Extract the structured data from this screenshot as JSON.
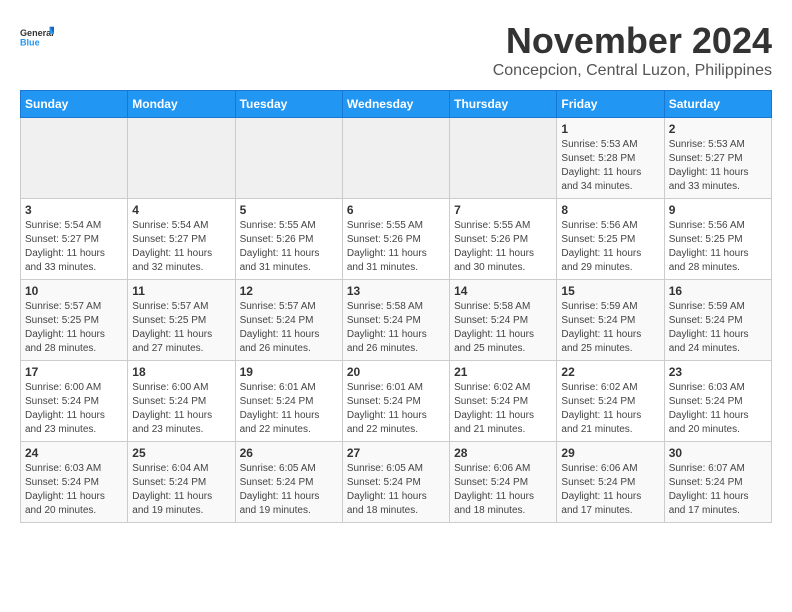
{
  "logo": {
    "line1": "General",
    "line2": "Blue"
  },
  "title": "November 2024",
  "location": "Concepcion, Central Luzon, Philippines",
  "weekdays": [
    "Sunday",
    "Monday",
    "Tuesday",
    "Wednesday",
    "Thursday",
    "Friday",
    "Saturday"
  ],
  "weeks": [
    [
      {
        "day": "",
        "info": ""
      },
      {
        "day": "",
        "info": ""
      },
      {
        "day": "",
        "info": ""
      },
      {
        "day": "",
        "info": ""
      },
      {
        "day": "",
        "info": ""
      },
      {
        "day": "1",
        "info": "Sunrise: 5:53 AM\nSunset: 5:28 PM\nDaylight: 11 hours and 34 minutes."
      },
      {
        "day": "2",
        "info": "Sunrise: 5:53 AM\nSunset: 5:27 PM\nDaylight: 11 hours and 33 minutes."
      }
    ],
    [
      {
        "day": "3",
        "info": "Sunrise: 5:54 AM\nSunset: 5:27 PM\nDaylight: 11 hours and 33 minutes."
      },
      {
        "day": "4",
        "info": "Sunrise: 5:54 AM\nSunset: 5:27 PM\nDaylight: 11 hours and 32 minutes."
      },
      {
        "day": "5",
        "info": "Sunrise: 5:55 AM\nSunset: 5:26 PM\nDaylight: 11 hours and 31 minutes."
      },
      {
        "day": "6",
        "info": "Sunrise: 5:55 AM\nSunset: 5:26 PM\nDaylight: 11 hours and 31 minutes."
      },
      {
        "day": "7",
        "info": "Sunrise: 5:55 AM\nSunset: 5:26 PM\nDaylight: 11 hours and 30 minutes."
      },
      {
        "day": "8",
        "info": "Sunrise: 5:56 AM\nSunset: 5:25 PM\nDaylight: 11 hours and 29 minutes."
      },
      {
        "day": "9",
        "info": "Sunrise: 5:56 AM\nSunset: 5:25 PM\nDaylight: 11 hours and 28 minutes."
      }
    ],
    [
      {
        "day": "10",
        "info": "Sunrise: 5:57 AM\nSunset: 5:25 PM\nDaylight: 11 hours and 28 minutes."
      },
      {
        "day": "11",
        "info": "Sunrise: 5:57 AM\nSunset: 5:25 PM\nDaylight: 11 hours and 27 minutes."
      },
      {
        "day": "12",
        "info": "Sunrise: 5:57 AM\nSunset: 5:24 PM\nDaylight: 11 hours and 26 minutes."
      },
      {
        "day": "13",
        "info": "Sunrise: 5:58 AM\nSunset: 5:24 PM\nDaylight: 11 hours and 26 minutes."
      },
      {
        "day": "14",
        "info": "Sunrise: 5:58 AM\nSunset: 5:24 PM\nDaylight: 11 hours and 25 minutes."
      },
      {
        "day": "15",
        "info": "Sunrise: 5:59 AM\nSunset: 5:24 PM\nDaylight: 11 hours and 25 minutes."
      },
      {
        "day": "16",
        "info": "Sunrise: 5:59 AM\nSunset: 5:24 PM\nDaylight: 11 hours and 24 minutes."
      }
    ],
    [
      {
        "day": "17",
        "info": "Sunrise: 6:00 AM\nSunset: 5:24 PM\nDaylight: 11 hours and 23 minutes."
      },
      {
        "day": "18",
        "info": "Sunrise: 6:00 AM\nSunset: 5:24 PM\nDaylight: 11 hours and 23 minutes."
      },
      {
        "day": "19",
        "info": "Sunrise: 6:01 AM\nSunset: 5:24 PM\nDaylight: 11 hours and 22 minutes."
      },
      {
        "day": "20",
        "info": "Sunrise: 6:01 AM\nSunset: 5:24 PM\nDaylight: 11 hours and 22 minutes."
      },
      {
        "day": "21",
        "info": "Sunrise: 6:02 AM\nSunset: 5:24 PM\nDaylight: 11 hours and 21 minutes."
      },
      {
        "day": "22",
        "info": "Sunrise: 6:02 AM\nSunset: 5:24 PM\nDaylight: 11 hours and 21 minutes."
      },
      {
        "day": "23",
        "info": "Sunrise: 6:03 AM\nSunset: 5:24 PM\nDaylight: 11 hours and 20 minutes."
      }
    ],
    [
      {
        "day": "24",
        "info": "Sunrise: 6:03 AM\nSunset: 5:24 PM\nDaylight: 11 hours and 20 minutes."
      },
      {
        "day": "25",
        "info": "Sunrise: 6:04 AM\nSunset: 5:24 PM\nDaylight: 11 hours and 19 minutes."
      },
      {
        "day": "26",
        "info": "Sunrise: 6:05 AM\nSunset: 5:24 PM\nDaylight: 11 hours and 19 minutes."
      },
      {
        "day": "27",
        "info": "Sunrise: 6:05 AM\nSunset: 5:24 PM\nDaylight: 11 hours and 18 minutes."
      },
      {
        "day": "28",
        "info": "Sunrise: 6:06 AM\nSunset: 5:24 PM\nDaylight: 11 hours and 18 minutes."
      },
      {
        "day": "29",
        "info": "Sunrise: 6:06 AM\nSunset: 5:24 PM\nDaylight: 11 hours and 17 minutes."
      },
      {
        "day": "30",
        "info": "Sunrise: 6:07 AM\nSunset: 5:24 PM\nDaylight: 11 hours and 17 minutes."
      }
    ]
  ]
}
